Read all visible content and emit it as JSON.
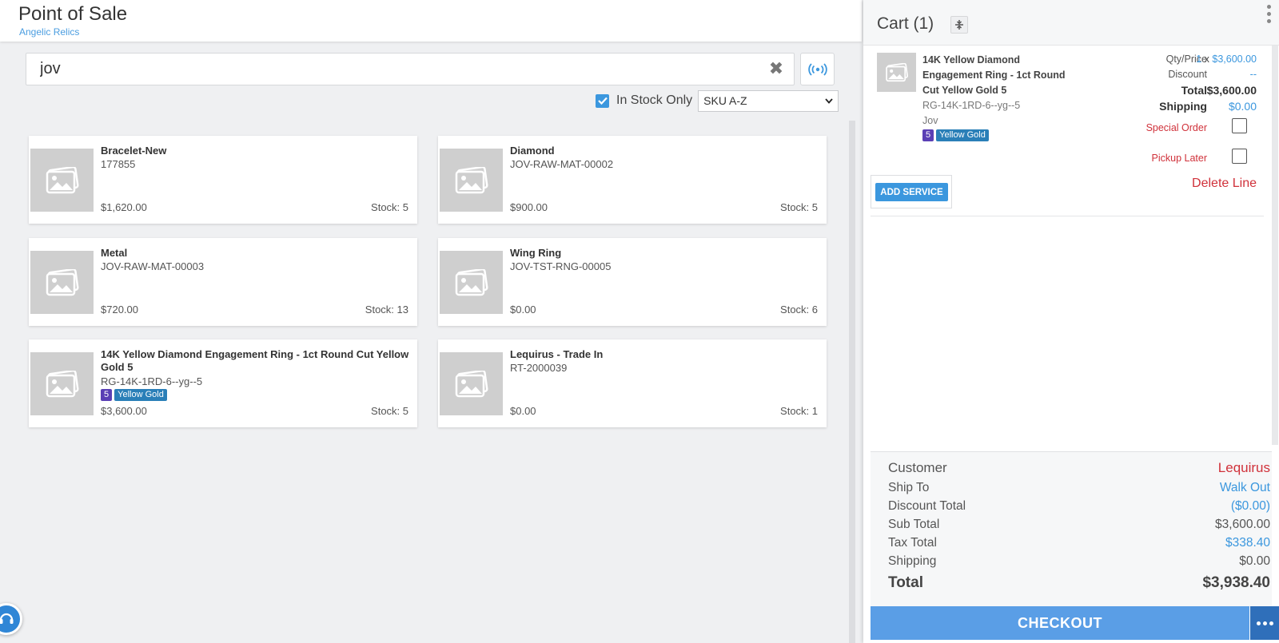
{
  "header": {
    "title": "Point of Sale",
    "store": "Angelic Relics"
  },
  "search": {
    "value": "jov",
    "placeholder": ""
  },
  "filters": {
    "in_stock_label": "In Stock Only",
    "in_stock_checked": true,
    "sort_value": "SKU A-Z"
  },
  "products": [
    {
      "name": "Bracelet-New",
      "sku": "177855",
      "price": "$1,620.00",
      "stock": "Stock: 5"
    },
    {
      "name": "Diamond",
      "sku": "JOV-RAW-MAT-00002",
      "price": "$900.00",
      "stock": "Stock: 5"
    },
    {
      "name": "Metal",
      "sku": "JOV-RAW-MAT-00003",
      "price": "$720.00",
      "stock": "Stock: 13"
    },
    {
      "name": "Wing Ring",
      "sku": "JOV-TST-RNG-00005",
      "price": "$0.00",
      "stock": "Stock: 6"
    },
    {
      "name": "14K Yellow Diamond Engagement Ring - 1ct Round Cut Yellow Gold 5",
      "sku": "RG-14K-1RD-6--yg--5",
      "size_tag": "5",
      "metal_tag": "Yellow Gold",
      "price": "$3,600.00",
      "stock": "Stock: 5"
    },
    {
      "name": "Lequirus - Trade In",
      "sku": "RT-2000039",
      "price": "$0.00",
      "stock": "Stock: 1"
    }
  ],
  "cart": {
    "title": "Cart (1)",
    "line": {
      "name": "14K Yellow Diamond Engagement Ring - 1ct Round Cut Yellow Gold 5",
      "sku": "RG-14K-1RD-6--yg--5",
      "vendor": "Jov",
      "size_tag": "5",
      "metal_tag": "Yellow Gold",
      "qty_price_label": "Qty/Price",
      "qty": "1",
      "qty_sep": "x",
      "unit_price": "$3,600.00",
      "discount_label": "Discount",
      "discount_value": "--",
      "total_label": "Total",
      "total_value": "$3,600.00",
      "shipping_label": "Shipping",
      "shipping_value": "$0.00",
      "special_order_label": "Special Order",
      "pickup_later_label": "Pickup Later",
      "add_service_label": "ADD SERVICE",
      "delete_label": "Delete Line"
    },
    "summary": {
      "customer_label": "Customer",
      "customer_value": "Lequirus",
      "ship_to_label": "Ship To",
      "ship_to_value": "Walk Out",
      "discount_total_label": "Discount Total",
      "discount_total_value": "($0.00)",
      "sub_total_label": "Sub Total",
      "sub_total_value": "$3,600.00",
      "tax_total_label": "Tax Total",
      "tax_total_value": "$338.40",
      "shipping_label": "Shipping",
      "shipping_value": "$0.00",
      "total_label": "Total",
      "total_value": "$3,938.40"
    },
    "checkout_label": "CHECKOUT"
  },
  "colors": {
    "accent": "#3b97de",
    "danger": "#d0313a",
    "checkout": "#5a9ee6",
    "tag_size": "#5a3fb5",
    "tag_metal": "#2a7fb8"
  }
}
